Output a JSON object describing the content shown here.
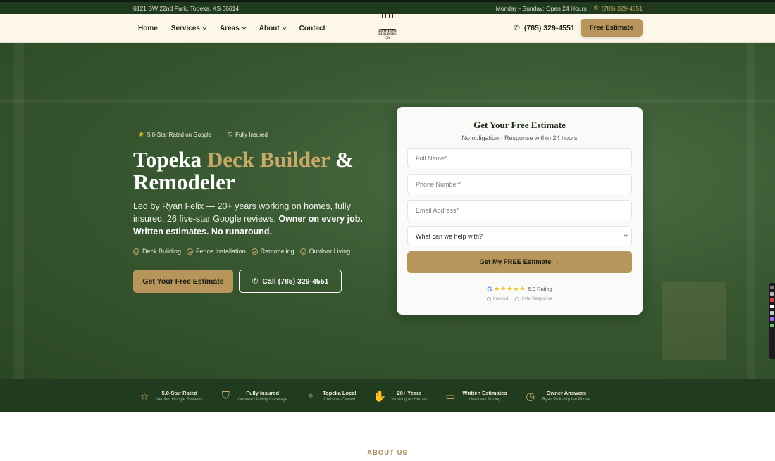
{
  "topbar": {
    "address": "6121 SW 22nd Park, Topeka, KS 66614",
    "hours": "Monday - Sunday: Open 24 Hours",
    "phone": "(785) 329-4551"
  },
  "nav": {
    "items": [
      {
        "label": "Home",
        "dropdown": false
      },
      {
        "label": "Services",
        "dropdown": true
      },
      {
        "label": "Areas",
        "dropdown": true
      },
      {
        "label": "About",
        "dropdown": true
      },
      {
        "label": "Contact",
        "dropdown": false
      }
    ],
    "logo": {
      "line1": "KINGDOM",
      "line2": "BUILDERS",
      "line3": "CO."
    },
    "phone": "(785) 329-4551",
    "cta": "Free Estimate"
  },
  "hero": {
    "badge_rating": "5.0-Star Rated on Google",
    "badge_insured": "Fully Insured",
    "title_part1": "Topeka ",
    "title_highlight": "Deck Builder",
    "title_part2": " & Remodeler",
    "lead_plain": "Led by Ryan Felix — 20+ years working on homes, fully insured, 26 five-star Google reviews. ",
    "lead_bold": "Owner on every job. Written estimates. No runaround.",
    "services": [
      "Deck Building",
      "Fence Installation",
      "Remodeling",
      "Outdoor Living"
    ],
    "cta_primary": "Get Your Free Estimate",
    "cta_secondary": "Call (785) 329-4551"
  },
  "form": {
    "title": "Get Your Free Estimate",
    "subtitle": "No obligation · Response within 24 hours",
    "name_placeholder": "Full Name*",
    "phone_placeholder": "Phone Number*",
    "email_placeholder": "Email Address*",
    "select_value": "What can we help with?",
    "submit": "Get My FREE Estimate →",
    "rating_stars": "★★★★★",
    "rating_text": "5.0 Rating",
    "meta_insured": "Insured",
    "meta_response": "24hr Response"
  },
  "trust": [
    {
      "icon": "star-icon",
      "title": "5.0-Star Rated",
      "sub": "Verified Google Reviews"
    },
    {
      "icon": "shield-icon",
      "title": "Fully Insured",
      "sub": "General Liability Coverage"
    },
    {
      "icon": "location-pin-icon",
      "title": "Topeka Local",
      "sub": "Christian-Owned"
    },
    {
      "icon": "thumbs-up-icon",
      "title": "20+ Years",
      "sub": "Working on Homes"
    },
    {
      "icon": "chat-icon",
      "title": "Written Estimates",
      "sub": "Line-Item Pricing"
    },
    {
      "icon": "clock-icon",
      "title": "Owner Answers",
      "sub": "Ryan Picks Up the Phone"
    }
  ],
  "about": {
    "eyebrow": "ABOUT US"
  },
  "colors": {
    "brand_green": "#1f3a1d",
    "gold": "#b7955b",
    "cream": "#fdf7ea"
  }
}
